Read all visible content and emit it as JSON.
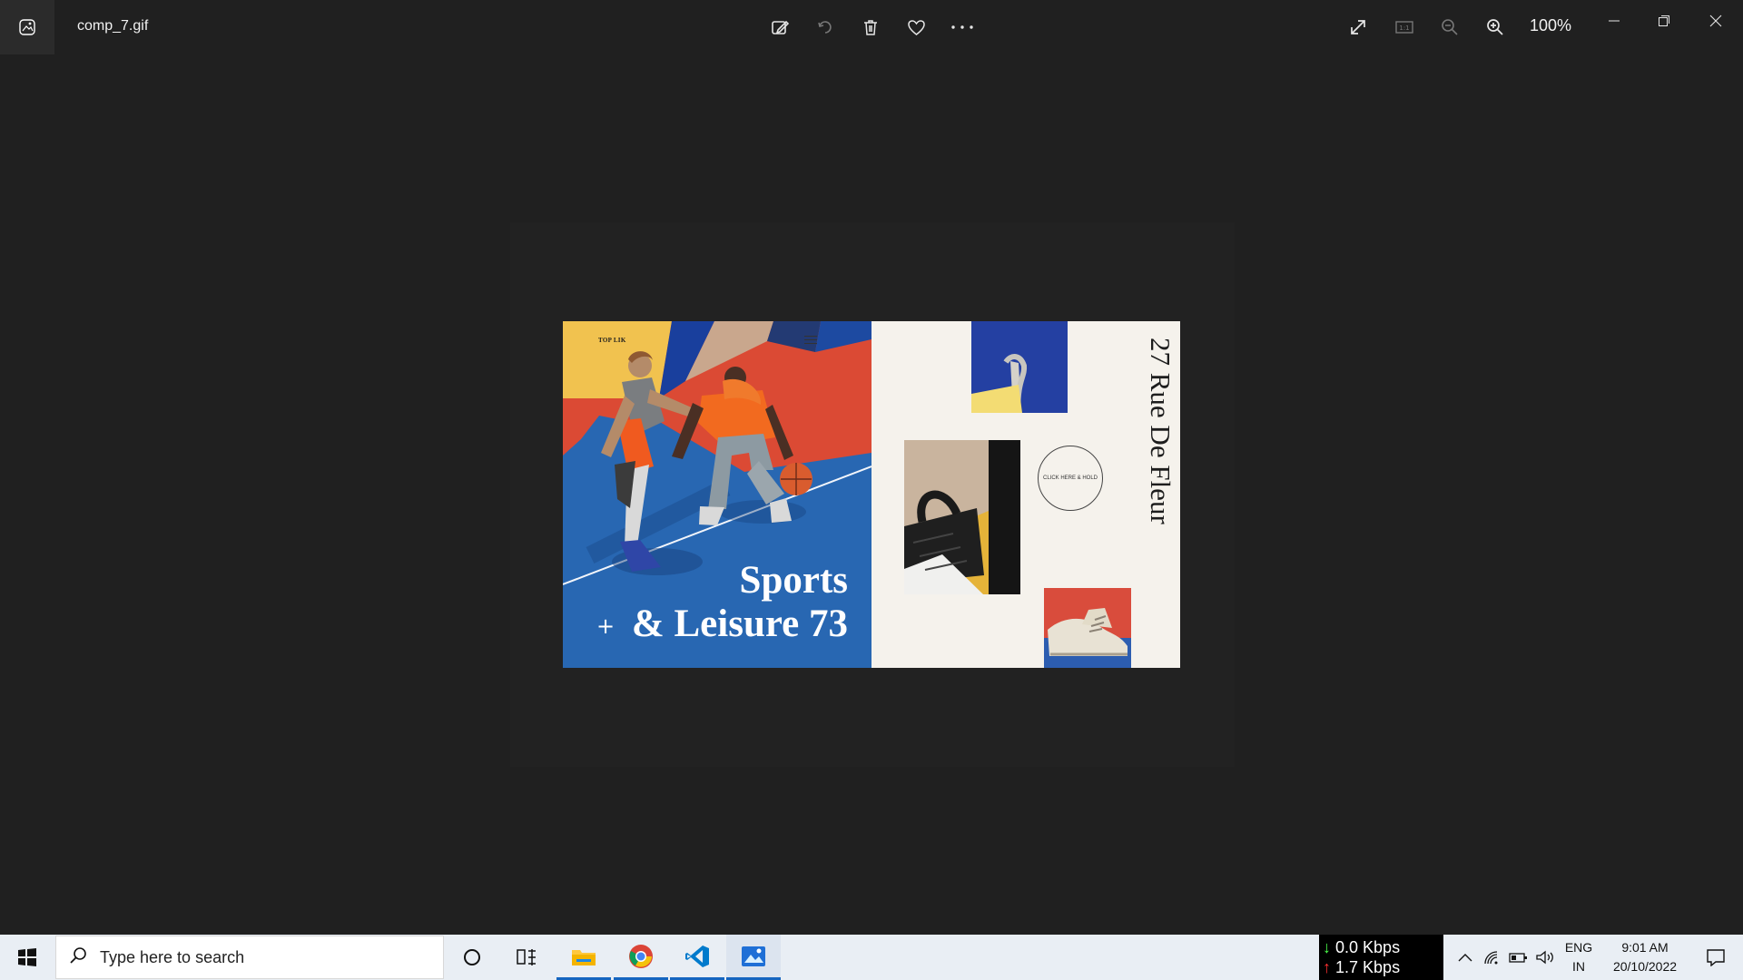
{
  "window": {
    "title": "comp_7.gif",
    "zoom": "100%"
  },
  "toolbar": {
    "edit": "edit-image",
    "rotate": "rotate",
    "delete": "delete",
    "favorite": "favorite",
    "more": "more-options",
    "fullscreen": "fullscreen",
    "actual_size": "1:1",
    "zoom_out": "zoom-out",
    "zoom_in": "zoom-in"
  },
  "image": {
    "brand": "TOP LIK",
    "headline_line1": "Sports",
    "headline_line2": "& Leisure 73",
    "side_text": "27 Rue De Fleur",
    "circle_text": "CLICK HERE & HOLD",
    "plus": "+",
    "colors": {
      "yellow": "#f1c24f",
      "red": "#db4a34",
      "blue": "#2867b2",
      "orange": "#f26a1f",
      "cream": "#f5f2ec"
    }
  },
  "taskbar": {
    "search_placeholder": "Type here to search",
    "download": "0.0 Kbps",
    "upload": "1.7 Kbps",
    "lang1": "ENG",
    "lang2": "IN",
    "time": "9:01 AM",
    "date": "20/10/2022"
  }
}
